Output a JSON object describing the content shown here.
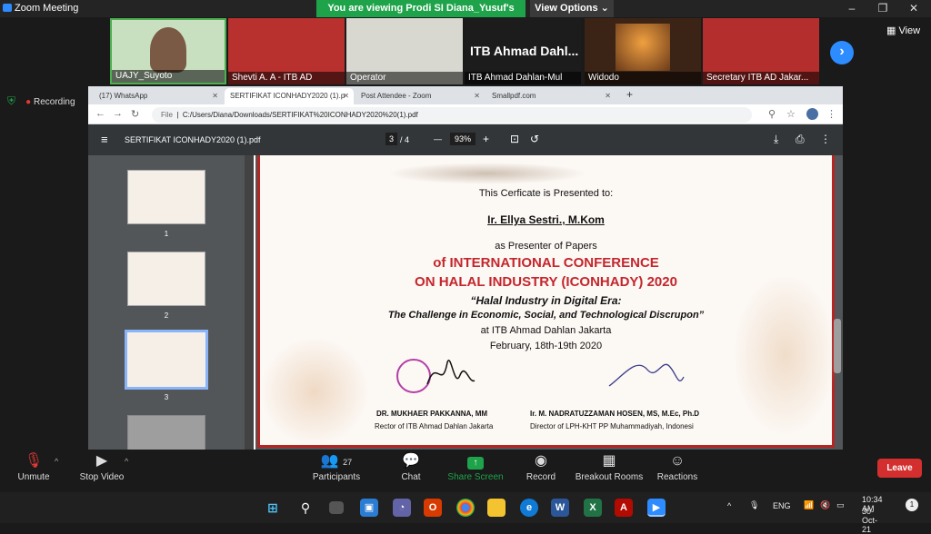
{
  "titlebar": {
    "title": "Zoom Meeting",
    "minimize": "–",
    "maximize": "❐",
    "close": "✕"
  },
  "banner": {
    "text": "You are viewing Prodi SI Diana_Yusuf's screen"
  },
  "view_options": {
    "label": "View Options ⌄"
  },
  "view_button": {
    "label": "View"
  },
  "recording": {
    "label": "Recording"
  },
  "participants_tiles": [
    {
      "name": "UAJY_Suyoto"
    },
    {
      "name": "Shevti A. A - ITB AD"
    },
    {
      "name": "Operator"
    },
    {
      "name": "ITB Ahmad Dahlan-Mul",
      "big": "ITB Ahmad Dahl..."
    },
    {
      "name": "Widodo"
    },
    {
      "name": "Secretary ITB AD Jakar..."
    }
  ],
  "browser": {
    "tabs": [
      {
        "label": "(17) WhatsApp"
      },
      {
        "label": "SERTIFIKAT ICONHADY2020 (1).p"
      },
      {
        "label": "Post Attendee - Zoom"
      },
      {
        "label": "Smallpdf.com"
      }
    ],
    "new_tab": "+",
    "address_prefix": "File",
    "address": "C:/Users/Diana/Downloads/SERTIFIKAT%20ICONHADY2020%20(1).pdf"
  },
  "pdf": {
    "filename": "SERTIFIKAT ICONHADY2020 (1).pdf",
    "page_current": "3",
    "page_total": "/  4",
    "zoom": "93%",
    "zoom_out": "—",
    "zoom_in": "+",
    "thumbnails": [
      "1",
      "2",
      "3"
    ]
  },
  "certificate": {
    "presented_to": "This Cerficate is Presented to:",
    "recipient": "Ir. Ellya Sestri., M.Kom",
    "role": "as Presenter of Papers",
    "conf_line1": "of INTERNATIONAL CONFERENCE",
    "conf_line2": "ON HALAL INDUSTRY (ICONHADY) 2020",
    "theme1": "“Halal Industry in Digital Era:",
    "theme2": "The Challenge in Economic, Social, and Technological Discrupon”",
    "venue": "at ITB Ahmad Dahlan Jakarta",
    "date": "February, 18th-19th 2020",
    "sign1_name": "DR. MUKHAER PAKKANNA, MM",
    "sign1_title": "Rector of ITB Ahmad Dahlan Jakarta",
    "sign2_name": "Ir. M. NADRATUZZAMAN HOSEN, MS, M.Ec, Ph.D",
    "sign2_title": "Director of LPH-KHT PP Muhammadiyah, Indonesi"
  },
  "toolbar": {
    "unmute": "Unmute",
    "stop_video": "Stop Video",
    "participants": "Participants",
    "participants_count": "27",
    "chat": "Chat",
    "share_screen": "Share Screen",
    "record": "Record",
    "breakout": "Breakout Rooms",
    "reactions": "Reactions",
    "leave": "Leave"
  },
  "taskbar": {
    "lang": "ENG",
    "time": "10:34 AM",
    "date": "30-Oct-21",
    "badge": "1"
  },
  "colors": {
    "zoom_blue": "#2d8cff",
    "share_green": "#1fa34a",
    "leave_red": "#d32f2f",
    "cert_red": "#b52524"
  }
}
